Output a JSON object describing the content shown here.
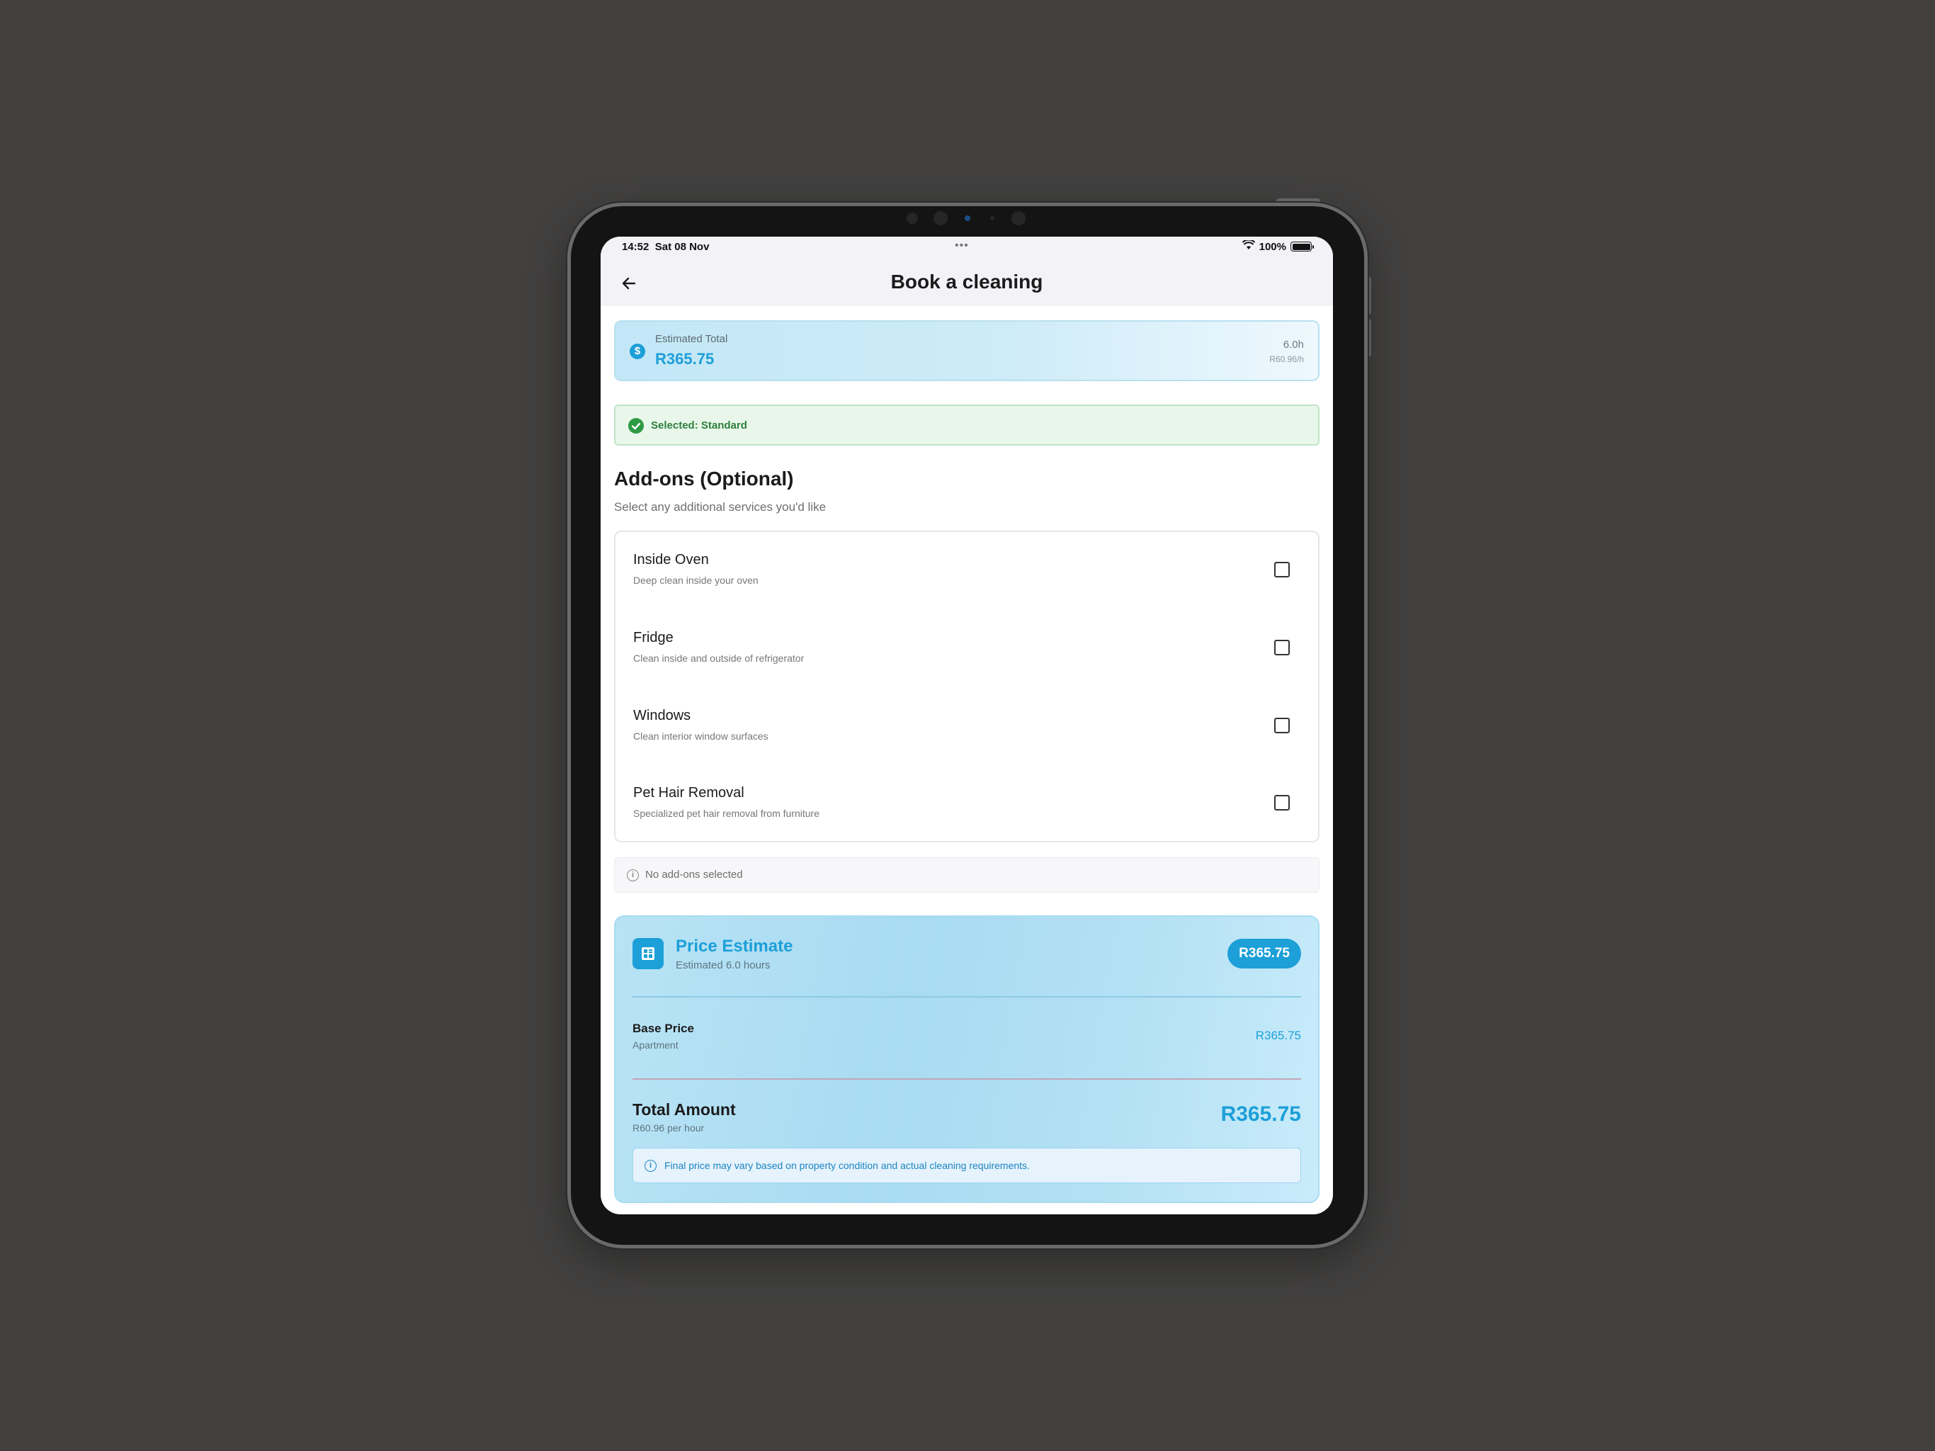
{
  "status_bar": {
    "time": "14:52",
    "date": "Sat 08 Nov",
    "battery": "100%"
  },
  "header": {
    "title": "Book a cleaning"
  },
  "estimate": {
    "label": "Estimated Total",
    "value": "R365.75",
    "hours": "6.0h",
    "rate": "R60.96/h"
  },
  "selected_banner": {
    "text": "Selected: Standard"
  },
  "addons": {
    "title": "Add-ons (Optional)",
    "subtitle": "Select any additional services you'd like",
    "items": [
      {
        "name": "Inside Oven",
        "description": "Deep clean inside your oven",
        "checked": false
      },
      {
        "name": "Fridge",
        "description": "Clean inside and outside of refrigerator",
        "checked": false
      },
      {
        "name": "Windows",
        "description": "Clean interior window surfaces",
        "checked": false
      },
      {
        "name": "Pet Hair Removal",
        "description": "Specialized pet hair removal from furniture",
        "checked": false
      }
    ],
    "empty_note": "No add-ons selected"
  },
  "price_estimate": {
    "title": "Price Estimate",
    "subtitle": "Estimated 6.0 hours",
    "badge": "R365.75",
    "base_label": "Base Price",
    "base_sub": "Apartment",
    "base_value": "R365.75",
    "total_label": "Total Amount",
    "total_sub": "R60.96 per hour",
    "total_value": "R365.75",
    "note": "Final price may vary based on property condition and actual cleaning requirements."
  },
  "colors": {
    "accent": "#1d9fd8",
    "success": "#2e9a44",
    "background": "#424140"
  },
  "icons": {
    "back": "arrow-left-icon",
    "estimate": "dollar-circle-icon",
    "selected": "check-circle-icon",
    "info": "info-icon",
    "price": "calculator-icon"
  }
}
